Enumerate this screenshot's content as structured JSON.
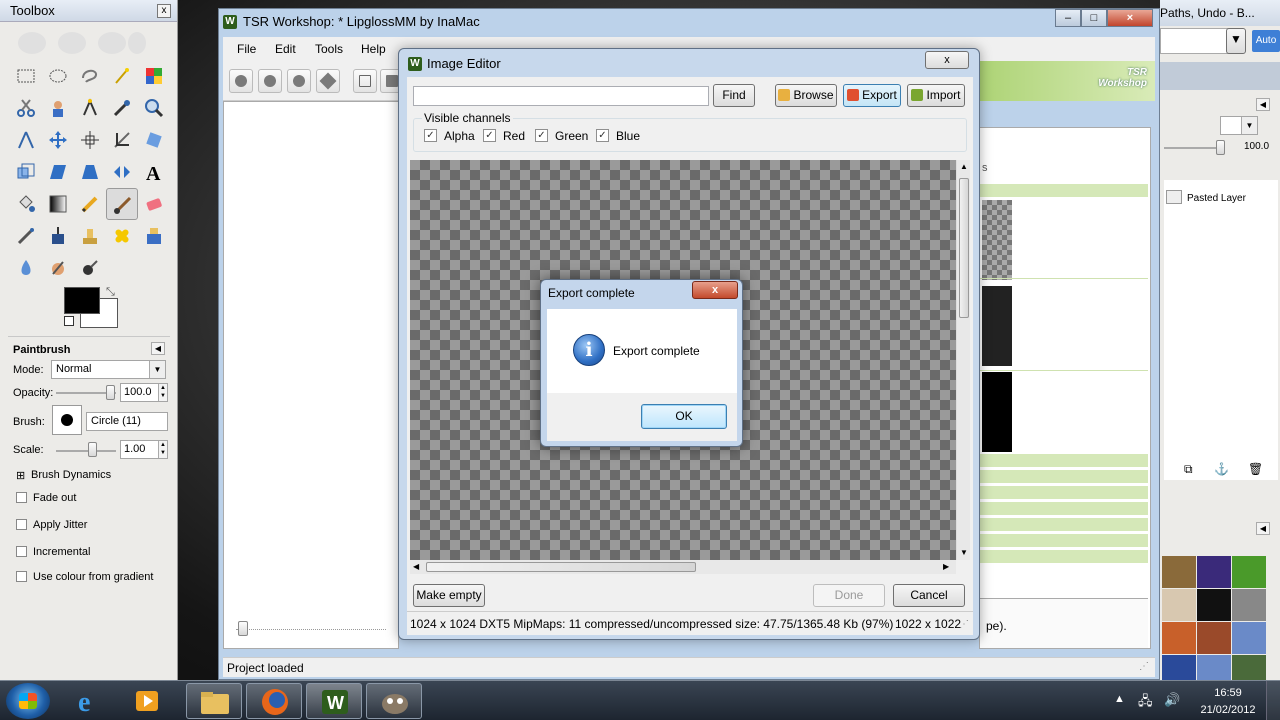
{
  "gimp_toolbox": {
    "title": "Toolbox",
    "close_glyph": "x",
    "tool_options": {
      "title": "Paintbrush",
      "mode_label": "Mode:",
      "mode_value": "Normal",
      "opacity_label": "Opacity:",
      "opacity_value": "100.0",
      "brush_label": "Brush:",
      "brush_value": "Circle (11)",
      "scale_label": "Scale:",
      "scale_value": "1.00",
      "brush_dynamics": "Brush Dynamics",
      "fade_out": "Fade out",
      "apply_jitter": "Apply Jitter",
      "incremental": "Incremental",
      "use_colour_from_gradient": "Use colour from gradient"
    }
  },
  "tsr_window": {
    "title": "TSR Workshop: * LipglossMM by InaMac",
    "app_icon": "W",
    "menu": [
      "File",
      "Edit",
      "Tools",
      "Help"
    ],
    "banner_logo_line1": "TSR",
    "banner_logo_line2": "Workshop",
    "status": "Project loaded",
    "right_tab_fragment": "s",
    "right_text_fragment": "pe).",
    "window_buttons": [
      "–",
      "□",
      "×"
    ]
  },
  "gimp_layers_dock": {
    "title_fragment": "Paths, Undo - B...",
    "auto_button": "Auto",
    "opacity_value": "100.0",
    "layer_name": "Pasted Layer"
  },
  "image_editor": {
    "title": "Image Editor",
    "close_glyph": "x",
    "search_value": "",
    "find_label": "Find",
    "browse_label": "Browse",
    "export_label": "Export",
    "import_label": "Import",
    "visible_channels_label": "Visible channels",
    "channels": [
      {
        "name": "Alpha",
        "checked": true
      },
      {
        "name": "Red",
        "checked": true
      },
      {
        "name": "Green",
        "checked": true
      },
      {
        "name": "Blue",
        "checked": true
      }
    ],
    "make_empty_label": "Make empty",
    "done_label": "Done",
    "cancel_label": "Cancel",
    "status_text": "1024 x 1024 DXT5 MipMaps: 11 compressed/uncompressed size: 47.75/1365.48 Kb (97%)",
    "dimensions_text": "1022 x 1022"
  },
  "message_box": {
    "title": "Export complete",
    "message": "Export complete",
    "ok_label": "OK",
    "icon": "information-icon",
    "close_glyph": "x"
  },
  "taskbar": {
    "time": "16:59",
    "date": "21/02/2012"
  },
  "colors": {
    "window_frame": "#bcd2ea",
    "dialog_body": "#f0f0f0",
    "tsr_green": "#d5e8b8",
    "gimp_panel": "#ecebe8",
    "taskbar": "#1d2530"
  }
}
